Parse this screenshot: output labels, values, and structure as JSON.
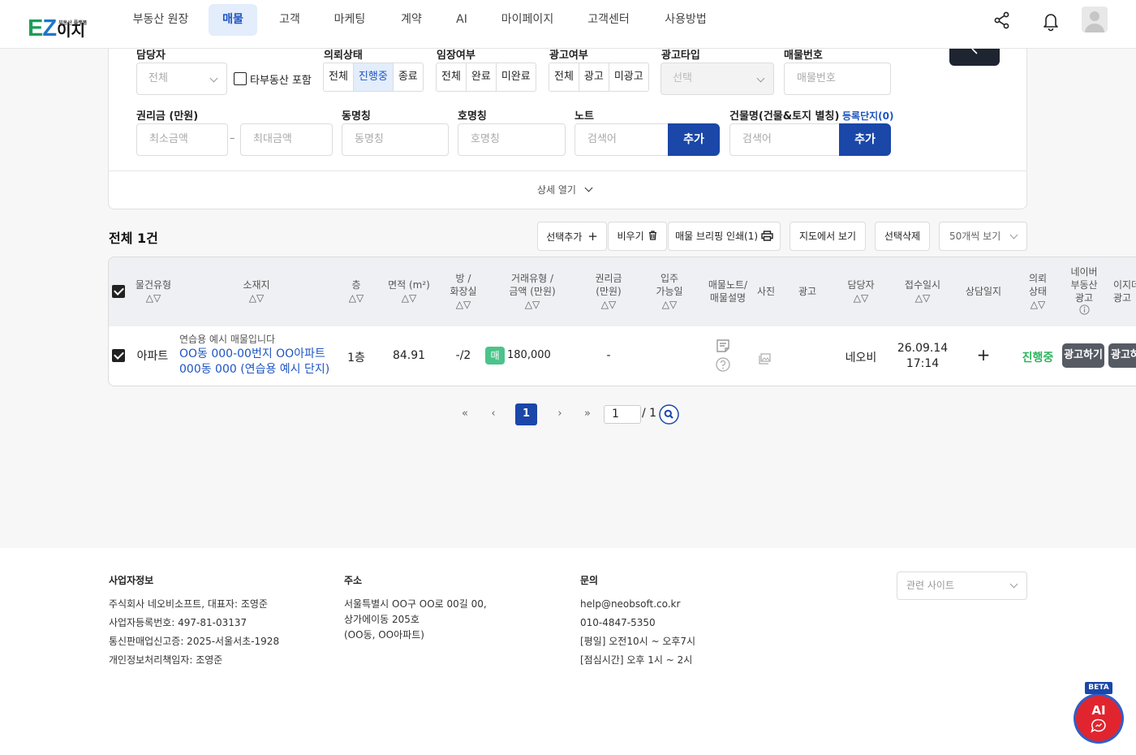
{
  "logo": {
    "brand_e": "E",
    "brand_z": "Z",
    "brand_text": "이지",
    "small_text": "부동산 플랫폼"
  },
  "nav": [
    "부동산 원장",
    "매물",
    "고객",
    "마케팅",
    "계약",
    "AI",
    "마이페이지",
    "고객센터",
    "사용방법"
  ],
  "filters": {
    "manager_label": "담당자",
    "manager_value": "전체",
    "other_realty_label": "타부동산 포함",
    "request_status_label": "의뢰상태",
    "request_status_options": [
      "전체",
      "진행중",
      "종료"
    ],
    "entry_label": "임장여부",
    "entry_options": [
      "전체",
      "완료",
      "미완료"
    ],
    "ad_label": "광고여부",
    "ad_options": [
      "전체",
      "광고",
      "미광고"
    ],
    "adtype_label": "광고타입",
    "adtype_value": "선택",
    "number_label": "매물번호",
    "number_placeholder": "매물번호",
    "premium_label": "권리금 (만원)",
    "premium_min": "최소금액",
    "premium_dash": "–",
    "premium_max": "최대금액",
    "dong_label": "동명칭",
    "dong_placeholder": "동명칭",
    "ho_label": "호명칭",
    "ho_placeholder": "호명칭",
    "note_label": "노트",
    "note_placeholder": "검색어",
    "note_add": "추가",
    "building_label": "건물명(건물&토지 별칭)",
    "building_link": "등록단지(0)",
    "building_placeholder": "검색어",
    "building_add": "추가",
    "detail_open": "상세 열기"
  },
  "list": {
    "total": "전체 1건",
    "btn_add": "선택추가",
    "btn_clear": "비우기",
    "btn_print": "매물 브리핑 인쇄(1)",
    "btn_map": "지도에서 보기",
    "btn_delete": "선택삭제",
    "page_size": "50개씩 보기"
  },
  "table": {
    "headers": {
      "type": "물건유형",
      "location": "소재지",
      "floor": "층",
      "area": "면적 (m²)",
      "rooms": "방 /\n화장실",
      "deal": "거래유형 /\n금액 (만원)",
      "premium": "권리금\n(만원)",
      "movein": "입주\n가능일",
      "note": "매물노트/\n매물설명",
      "photo": "사진",
      "ad": "광고",
      "manager": "담당자",
      "received": "접수일시",
      "consult": "상담일지",
      "status": "의뢰\n상태",
      "naver": "네이버\n부동산\n광고",
      "other_ad": "이지데\n광고",
      "sort": "△▽"
    },
    "rows": [
      {
        "type": "아파트",
        "sample_note": "연습용 예시 매물입니다",
        "address": "OO동 000-00번지 OO아파트 000동 000 (연습용 예시 단지)",
        "floor": "1층",
        "area": "84.91",
        "rooms": "-/2",
        "deal_badge": "매",
        "deal_amount": "180,000",
        "premium": "-",
        "manager": "네오비",
        "received_date": "26.09.14",
        "received_time": "17:14",
        "consult": "+",
        "status": "진행중",
        "ad_button": "광고하기",
        "ad_button2": "광고하"
      }
    ]
  },
  "pagination": {
    "first": "«",
    "prev": "‹",
    "current": "1",
    "next": "›",
    "last": "»",
    "input": "1",
    "total": "/ 1"
  },
  "footer": {
    "biz_title": "사업자정보",
    "biz_lines": [
      "주식회사 네오비소프트, 대표자: 조영준",
      "사업자등록번호: 497-81-03137",
      "통신판매업신고증: 2025-서울서초-1928",
      "개인정보처리책임자: 조영준"
    ],
    "addr_title": "주소",
    "addr_lines": [
      "서울특별시 OO구 OO로 00길 00,",
      "상가에이동 205호",
      "(OO동, OO아파트)"
    ],
    "contact_title": "문의",
    "contact_lines": [
      "help@neobsoft.co.kr",
      "010-4847-5350",
      "[평일] 오전10시 ~ 오후7시",
      "[점심시간] 오후 1시 ~ 2시"
    ],
    "related_sites": "관련 사이트"
  },
  "ai_widget": {
    "beta": "BETA",
    "label": "AI"
  }
}
